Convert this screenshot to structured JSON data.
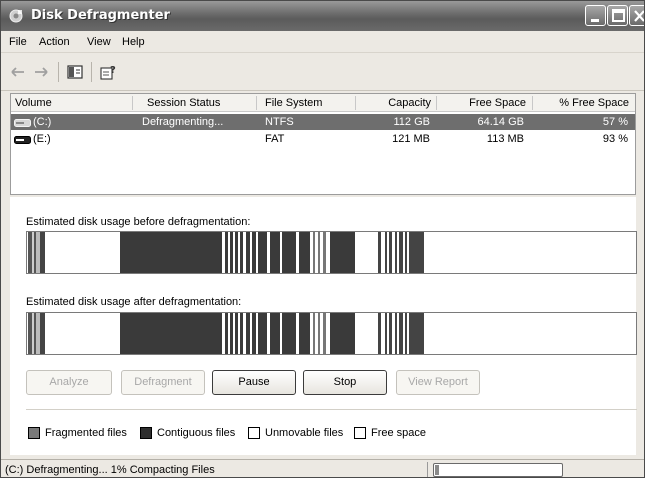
{
  "window": {
    "title": "Disk Defragmenter"
  },
  "menu": [
    "File",
    "Action",
    "View",
    "Help"
  ],
  "toolbar": {
    "icons": [
      "back-arrow-icon",
      "forward-arrow-icon",
      "console-tree-icon",
      "help-properties-icon"
    ]
  },
  "columns": [
    "Volume",
    "Session Status",
    "File System",
    "Capacity",
    "Free Space",
    "% Free Space"
  ],
  "volumes": [
    {
      "volume": "(C:)",
      "status": "Defragmenting...",
      "fs": "NTFS",
      "capacity": "112 GB",
      "free": "64.14 GB",
      "pct": "57 %",
      "selected": true
    },
    {
      "volume": "(E:)",
      "status": "",
      "fs": "FAT",
      "capacity": "121 MB",
      "free": "113 MB",
      "pct": "93 %",
      "selected": false
    }
  ],
  "analysis": {
    "before_label": "Estimated disk usage before defragmentation:",
    "after_label": "Estimated disk usage after defragmentation:"
  },
  "buttons": [
    {
      "label": "Analyze",
      "enabled": false
    },
    {
      "label": "Defragment",
      "enabled": false
    },
    {
      "label": "Pause",
      "enabled": true
    },
    {
      "label": "Stop",
      "enabled": true
    },
    {
      "label": "View Report",
      "enabled": false
    }
  ],
  "legend": [
    {
      "label": "Fragmented files",
      "color": "#7a7a7a"
    },
    {
      "label": "Contiguous files",
      "color": "#2e2e2e"
    },
    {
      "label": "Unmovable files",
      "color": "#ffffff"
    },
    {
      "label": "Free space",
      "color": "#ffffff"
    }
  ],
  "status": {
    "text": "(C:) Defragmenting... 1%  Compacting Files",
    "progress": 0.01
  },
  "colors": {
    "selected_row": "#6e6e6e",
    "title_bar": "#6e6e6e"
  }
}
